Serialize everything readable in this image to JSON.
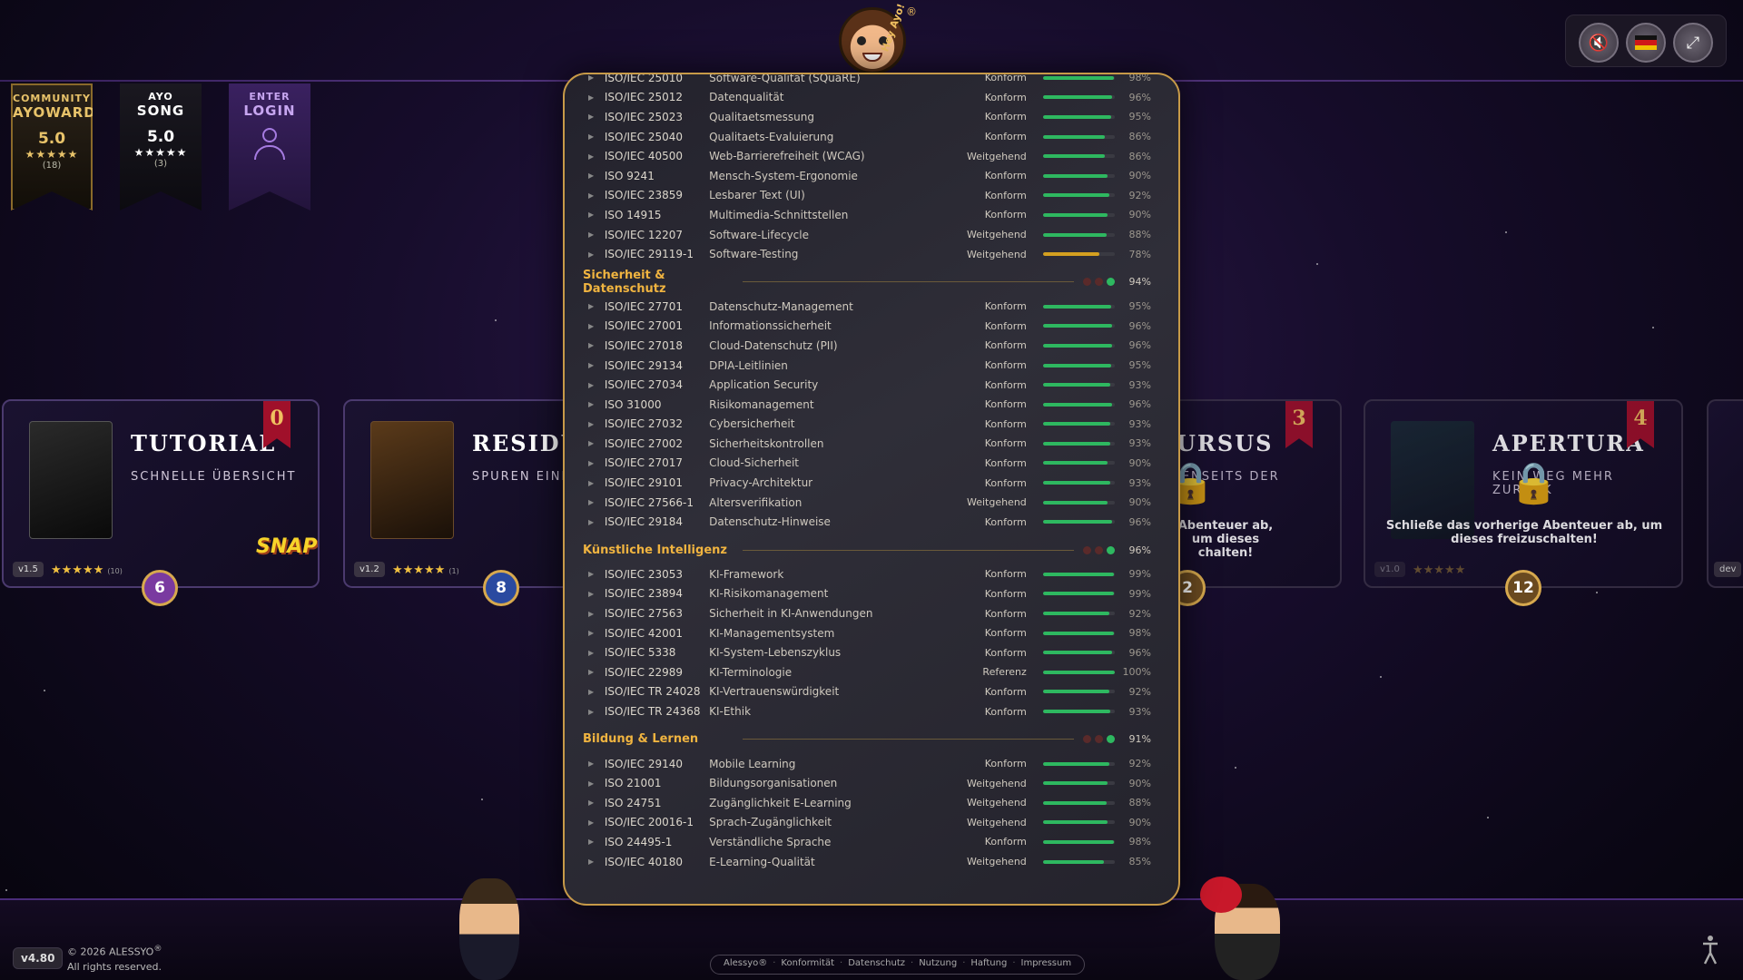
{
  "ribbons": [
    {
      "small": "COMMUNITY",
      "big": "AYOWARD",
      "score": "5.0",
      "stars": "★★★★★",
      "count": "(18)"
    },
    {
      "small": "AYO",
      "big": "SONG",
      "score": "5.0",
      "stars": "★★★★★",
      "count": "(3)"
    },
    {
      "small": "ENTER",
      "big": "LOGIN"
    }
  ],
  "controls": {
    "mute_icon": "speaker-muted-icon",
    "language_icon": "german-flag-icon",
    "fullscreen_icon": "expand-icon"
  },
  "mascot": {
    "hey": "Hey Ayo!",
    "reg": "®"
  },
  "cards": [
    {
      "title": "TUTORIAL",
      "subtitle": "SCHNELLE ÜBERSICHT",
      "version": "v1.5",
      "stars": "★★★★★",
      "count": "(10)",
      "number": "0",
      "badge": "6",
      "logo": "SNAP!"
    },
    {
      "title": "RESIDUU",
      "subtitle": "SPUREN EINER WELT",
      "version": "v1.2",
      "stars": "★★★★★",
      "count": "(1)",
      "badge": "8"
    },
    {
      "title": "URSUS",
      "subtitle": "JENSEITS DER",
      "number": "3",
      "lock_text": "Abenteuer ab, um dieses chalten!",
      "badge": "2"
    },
    {
      "title": "APERTURA",
      "subtitle": "KEIN WEG MEHR ZURÜCK",
      "number": "4",
      "lock_text": "Schließe das vorherige Abenteuer ab, um dieses freizuschalten!",
      "version": "v1.0",
      "stars": "★★★★★",
      "badge": "12"
    },
    {
      "version": "dev"
    }
  ],
  "panel": {
    "top_rows": [
      {
        "code": "ISO/IEC 25010",
        "name": "Software-Qualität (SQuaRE)",
        "status": "Konform",
        "pct": "98%",
        "value": 98
      },
      {
        "code": "ISO/IEC 25012",
        "name": "Datenqualität",
        "status": "Konform",
        "pct": "96%",
        "value": 96
      },
      {
        "code": "ISO/IEC 25023",
        "name": "Qualitaetsmessung",
        "status": "Konform",
        "pct": "95%",
        "value": 95
      },
      {
        "code": "ISO/IEC 25040",
        "name": "Qualitaets-Evaluierung",
        "status": "Konform",
        "pct": "86%",
        "value": 86
      },
      {
        "code": "ISO/IEC 40500",
        "name": "Web-Barrierefreiheit (WCAG)",
        "status": "Weitgehend",
        "pct": "86%",
        "value": 86
      },
      {
        "code": "ISO 9241",
        "name": "Mensch-System-Ergonomie",
        "status": "Konform",
        "pct": "90%",
        "value": 90
      },
      {
        "code": "ISO/IEC 23859",
        "name": "Lesbarer Text (UI)",
        "status": "Konform",
        "pct": "92%",
        "value": 92
      },
      {
        "code": "ISO 14915",
        "name": "Multimedia-Schnittstellen",
        "status": "Konform",
        "pct": "90%",
        "value": 90
      },
      {
        "code": "ISO/IEC 12207",
        "name": "Software-Lifecycle",
        "status": "Weitgehend",
        "pct": "88%",
        "value": 88
      },
      {
        "code": "ISO/IEC 29119-1",
        "name": "Software-Testing",
        "status": "Weitgehend",
        "pct": "78%",
        "value": 78,
        "color": "#d4a020"
      }
    ],
    "sections": [
      {
        "title": "Sicherheit & Datenschutz",
        "pct": "94%",
        "rows": [
          {
            "code": "ISO/IEC 27701",
            "name": "Datenschutz-Management",
            "status": "Konform",
            "pct": "95%",
            "value": 95
          },
          {
            "code": "ISO/IEC 27001",
            "name": "Informationssicherheit",
            "status": "Konform",
            "pct": "96%",
            "value": 96
          },
          {
            "code": "ISO/IEC 27018",
            "name": "Cloud-Datenschutz (PII)",
            "status": "Konform",
            "pct": "96%",
            "value": 96
          },
          {
            "code": "ISO/IEC 29134",
            "name": "DPIA-Leitlinien",
            "status": "Konform",
            "pct": "95%",
            "value": 95
          },
          {
            "code": "ISO/IEC 27034",
            "name": "Application Security",
            "status": "Konform",
            "pct": "93%",
            "value": 93
          },
          {
            "code": "ISO 31000",
            "name": "Risikomanagement",
            "status": "Konform",
            "pct": "96%",
            "value": 96
          },
          {
            "code": "ISO/IEC 27032",
            "name": "Cybersicherheit",
            "status": "Konform",
            "pct": "93%",
            "value": 93
          },
          {
            "code": "ISO/IEC 27002",
            "name": "Sicherheitskontrollen",
            "status": "Konform",
            "pct": "93%",
            "value": 93
          },
          {
            "code": "ISO/IEC 27017",
            "name": "Cloud-Sicherheit",
            "status": "Konform",
            "pct": "90%",
            "value": 90
          },
          {
            "code": "ISO/IEC 29101",
            "name": "Privacy-Architektur",
            "status": "Konform",
            "pct": "93%",
            "value": 93
          },
          {
            "code": "ISO/IEC 27566-1",
            "name": "Altersverifikation",
            "status": "Weitgehend",
            "pct": "90%",
            "value": 90
          },
          {
            "code": "ISO/IEC 29184",
            "name": "Datenschutz-Hinweise",
            "status": "Konform",
            "pct": "96%",
            "value": 96
          }
        ]
      },
      {
        "title": "Künstliche Intelligenz",
        "pct": "96%",
        "rows": [
          {
            "code": "ISO/IEC 23053",
            "name": "KI-Framework",
            "status": "Konform",
            "pct": "99%",
            "value": 99
          },
          {
            "code": "ISO/IEC 23894",
            "name": "KI-Risikomanagement",
            "status": "Konform",
            "pct": "99%",
            "value": 99
          },
          {
            "code": "ISO/IEC 27563",
            "name": "Sicherheit in KI-Anwendungen",
            "status": "Konform",
            "pct": "92%",
            "value": 92
          },
          {
            "code": "ISO/IEC 42001",
            "name": "KI-Managementsystem",
            "status": "Konform",
            "pct": "98%",
            "value": 98
          },
          {
            "code": "ISO/IEC 5338",
            "name": "KI-System-Lebenszyklus",
            "status": "Konform",
            "pct": "96%",
            "value": 96
          },
          {
            "code": "ISO/IEC 22989",
            "name": "KI-Terminologie",
            "status": "Referenz",
            "pct": "100%",
            "value": 100
          },
          {
            "code": "ISO/IEC TR 24028",
            "name": "KI-Vertrauenswürdigkeit",
            "status": "Konform",
            "pct": "92%",
            "value": 92
          },
          {
            "code": "ISO/IEC TR 24368",
            "name": "KI-Ethik",
            "status": "Konform",
            "pct": "93%",
            "value": 93
          }
        ]
      },
      {
        "title": "Bildung & Lernen",
        "pct": "91%",
        "rows": [
          {
            "code": "ISO/IEC 29140",
            "name": "Mobile Learning",
            "status": "Konform",
            "pct": "92%",
            "value": 92
          },
          {
            "code": "ISO 21001",
            "name": "Bildungsorganisationen",
            "status": "Weitgehend",
            "pct": "90%",
            "value": 90
          },
          {
            "code": "ISO 24751",
            "name": "Zugänglichkeit E-Learning",
            "status": "Weitgehend",
            "pct": "88%",
            "value": 88
          },
          {
            "code": "ISO/IEC 20016-1",
            "name": "Sprach-Zugänglichkeit",
            "status": "Weitgehend",
            "pct": "90%",
            "value": 90
          },
          {
            "code": "ISO 24495-1",
            "name": "Verständliche Sprache",
            "status": "Konform",
            "pct": "98%",
            "value": 98
          },
          {
            "code": "ISO/IEC 40180",
            "name": "E-Learning-Qualität",
            "status": "Weitgehend",
            "pct": "85%",
            "value": 85
          }
        ]
      }
    ],
    "dot_colors": [
      "#5a2a2a",
      "#5a2a2a",
      "#2eb860"
    ]
  },
  "footer": {
    "version": "v4.80",
    "copyright": "© 2026 ALESSYO",
    "reg": "®",
    "rights": "All rights reserved.",
    "links": [
      "Alessyo®",
      "Konformität",
      "Datenschutz",
      "Nutzung",
      "Haftung",
      "Impressum"
    ],
    "separator": "·"
  },
  "colors": {
    "accent": "#f0b440",
    "bar": "#2eb860",
    "panel_border": "#c79a48"
  }
}
